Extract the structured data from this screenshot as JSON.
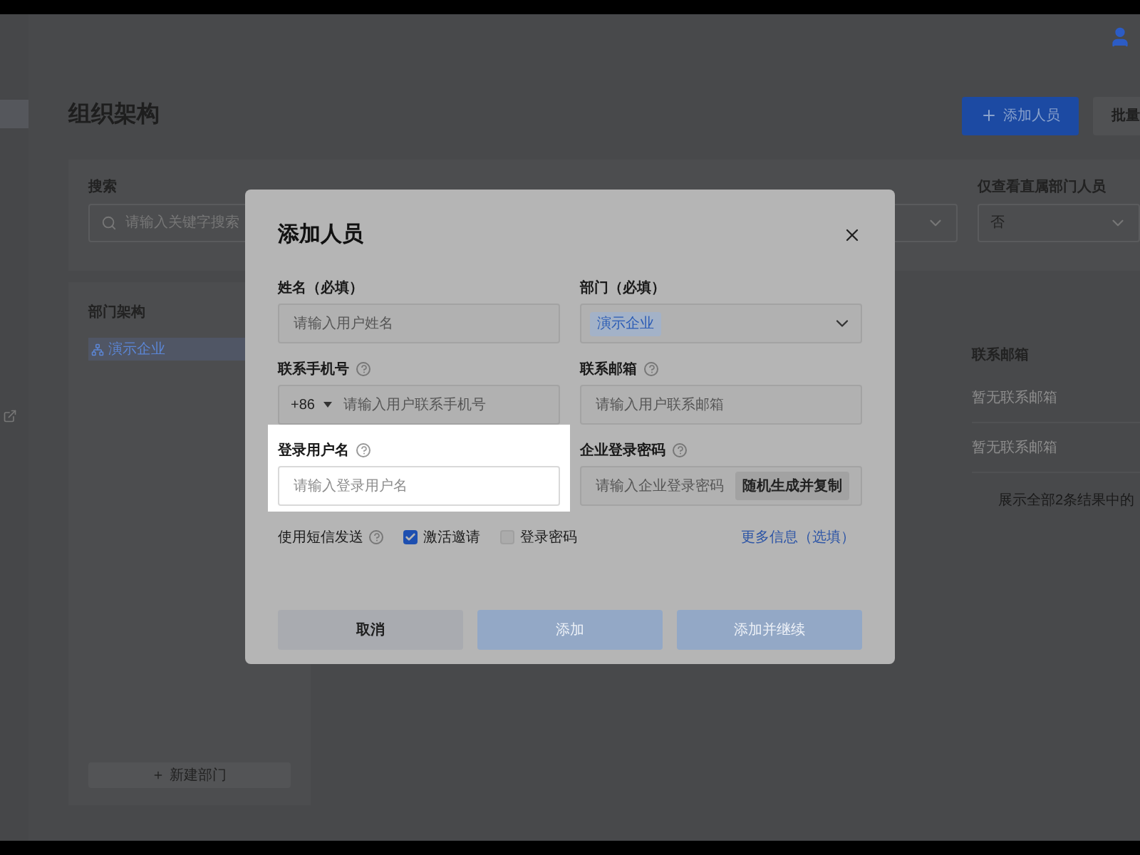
{
  "page": {
    "title": "组织架构",
    "actions": [
      {
        "label": "添加人员",
        "kind": "primary"
      },
      {
        "label": "批量",
        "kind": "secondary"
      }
    ]
  },
  "filters": [
    {
      "label": "搜索",
      "kind": "search",
      "placeholder": "请输入关键字搜索"
    },
    {
      "kind": "select"
    },
    {
      "label": "仅查看直属部门人员",
      "kind": "select",
      "value": "否"
    }
  ],
  "departments": {
    "title": "部门架构",
    "items": [
      {
        "label": "演示企业",
        "selected": true
      }
    ],
    "add_button": "新建部门"
  },
  "table": {
    "columns": [
      "联系邮箱"
    ],
    "rows": [
      [
        "暂无联系邮箱"
      ],
      [
        "暂无联系邮箱"
      ]
    ],
    "footer": "展示全部2条结果中的"
  },
  "dialog": {
    "title": "添加人员",
    "fields": [
      {
        "label": "姓名（必填）",
        "kind": "text",
        "help": false,
        "highlighted": false,
        "placeholder": "请输入用户姓名"
      },
      {
        "label": "部门（必填）",
        "kind": "tag-select",
        "help": false,
        "highlighted": false,
        "value": "演示企业"
      },
      {
        "label": "联系手机号",
        "kind": "phone",
        "help": true,
        "highlighted": false,
        "prefix": "+86",
        "placeholder": "请输入用户联系手机号"
      },
      {
        "label": "联系邮箱",
        "kind": "text",
        "help": true,
        "highlighted": false,
        "placeholder": "请输入用户联系邮箱"
      },
      {
        "label": "登录用户名",
        "kind": "text",
        "help": true,
        "highlighted": true,
        "placeholder": "请输入登录用户名"
      },
      {
        "label": "企业登录密码",
        "kind": "password",
        "help": true,
        "highlighted": false,
        "placeholder": "请输入企业登录密码",
        "action": "随机生成并复制"
      }
    ],
    "sms": {
      "label": "使用短信发送",
      "options": [
        {
          "label": "激活邀请",
          "checked": true
        },
        {
          "label": "登录密码",
          "checked": false
        }
      ]
    },
    "more_link": "更多信息（选填）",
    "buttons": [
      {
        "label": "取消",
        "kind": "cancel",
        "disabled": false
      },
      {
        "label": "添加",
        "kind": "primary",
        "disabled": true
      },
      {
        "label": "添加并继续",
        "kind": "primary",
        "disabled": true
      }
    ]
  }
}
